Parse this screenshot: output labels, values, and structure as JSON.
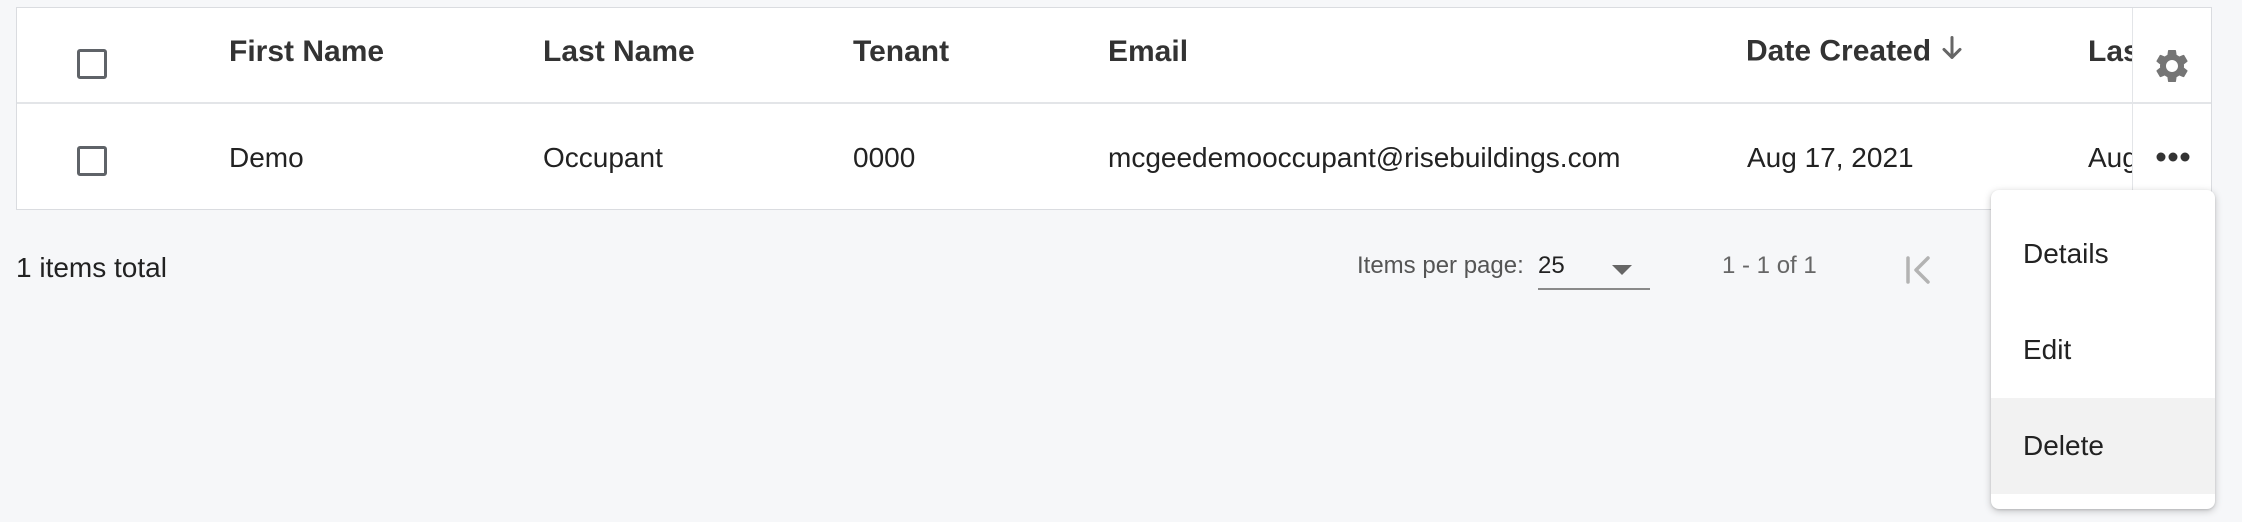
{
  "table": {
    "columns": [
      {
        "label": "First Name"
      },
      {
        "label": "Last Name"
      },
      {
        "label": "Tenant"
      },
      {
        "label": "Email"
      },
      {
        "label": "Date Created"
      },
      {
        "label": "Las"
      }
    ],
    "sort": {
      "column": "Date Created",
      "direction": "descending",
      "icon": "arrow-down-icon"
    },
    "rows": [
      {
        "first_name": "Demo",
        "last_name": "Occupant",
        "tenant": "0000",
        "email": "mcgeedemooccupant@risebuildings.com",
        "date_created": "Aug 17, 2021",
        "last_partial": "Aug"
      }
    ],
    "settings_icon": "gear-icon",
    "row_actions_icon": "more-horizontal-icon"
  },
  "footer": {
    "total_label": "1 items total",
    "items_per_page_label": "Items per page:",
    "items_per_page_value": "25",
    "range_label": "1 - 1 of 1",
    "first_page_icon": "first-page-icon"
  },
  "row_menu": {
    "items": [
      {
        "label": "Details"
      },
      {
        "label": "Edit"
      },
      {
        "label": "Delete"
      }
    ],
    "highlighted": "Delete"
  },
  "colors": {
    "background": "#f6f7f9",
    "surface": "#ffffff",
    "icon_gray": "#757575",
    "checkbox_border": "#5f6368",
    "menu_hover": "#f2f2f2"
  }
}
